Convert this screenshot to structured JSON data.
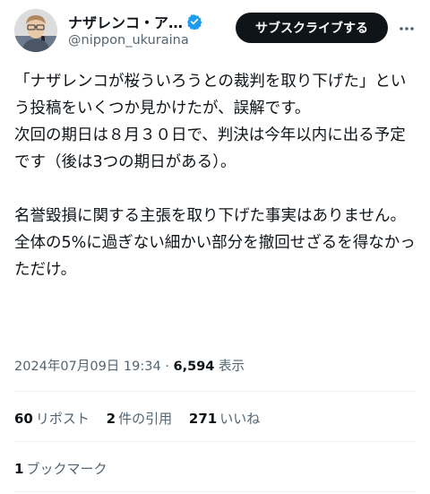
{
  "author": {
    "display_name": "ナザレンコ・ア…",
    "handle": "@nippon_ukuraina",
    "verified": true,
    "avatar_icon": "profile-photo"
  },
  "actions": {
    "subscribe_label": "サブスクライブする",
    "more_icon": "more-dots-icon"
  },
  "tweet": {
    "paragraph_1": "「ナザレンコが桜ういろうとの裁判を取り下げた」という投稿をいくつか見かけたが、誤解です。",
    "paragraph_2": "次回の期日は８月３０日で、判決は今年以内に出る予定です（後は3つの期日がある）。",
    "paragraph_3": "名誉毀損に関する主張を取り下げた事実はありません。全体の5%に過ぎない細かい部分を撤回せざるを得なかっただけ。"
  },
  "meta": {
    "timestamp": "2024年07月09日 19:34",
    "separator": "·",
    "views_count": "6,594",
    "views_label": "表示"
  },
  "stats": {
    "reposts_count": "60",
    "reposts_label": "リポスト",
    "quotes_count": "2",
    "quotes_label": "件の引用",
    "likes_count": "271",
    "likes_label": "いいね",
    "bookmarks_count": "1",
    "bookmarks_label": "ブックマーク"
  },
  "colors": {
    "text_primary": "#0f1419",
    "text_secondary": "#536471",
    "verified_blue": "#1d9bf0",
    "divider": "#eff3f4",
    "button_bg": "#0f1419"
  }
}
